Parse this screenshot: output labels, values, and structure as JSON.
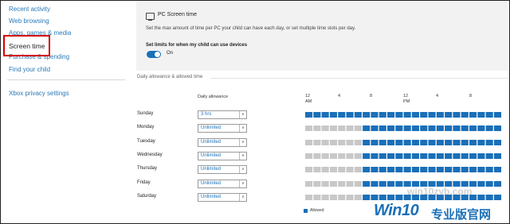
{
  "sidebar": {
    "items": [
      {
        "label": "Recent activity"
      },
      {
        "label": "Web browsing"
      },
      {
        "label": "Apps, games & media"
      },
      {
        "label": "Screen time"
      },
      {
        "label": "Purchase & spending"
      },
      {
        "label": "Find your child"
      },
      {
        "label": "Xbox privacy settings"
      }
    ]
  },
  "pc_screen_time": {
    "title": "PC Screen time",
    "description": "Set the max amount of time per PC your child can have each day, or set multiple time slots per day.",
    "limit_label": "Set limits for when my child can use devices",
    "toggle_state": "On"
  },
  "schedule": {
    "section_label": "Daily allowance & allowed time",
    "allowance_header": "Daily allowance",
    "time_labels": [
      {
        "top": "12",
        "bottom": "AM"
      },
      {
        "top": "4",
        "bottom": ""
      },
      {
        "top": "8",
        "bottom": ""
      },
      {
        "top": "12",
        "bottom": "PM"
      },
      {
        "top": "4",
        "bottom": ""
      },
      {
        "top": "8",
        "bottom": ""
      }
    ],
    "days": [
      {
        "name": "Sunday",
        "allowance": "3 hrs",
        "allowed_from": 0,
        "allowed_to": 24
      },
      {
        "name": "Monday",
        "allowance": "Unlimited",
        "allowed_from": 7,
        "allowed_to": 24
      },
      {
        "name": "Tuesday",
        "allowance": "Unlimited",
        "allowed_from": 7,
        "allowed_to": 24
      },
      {
        "name": "Wednesday",
        "allowance": "Unlimited",
        "allowed_from": 7,
        "allowed_to": 24
      },
      {
        "name": "Thursday",
        "allowance": "Unlimited",
        "allowed_from": 7,
        "allowed_to": 24
      },
      {
        "name": "Friday",
        "allowance": "Unlimited",
        "allowed_from": 7,
        "allowed_to": 24
      },
      {
        "name": "Saturday",
        "allowance": "Unlimited",
        "allowed_from": 7,
        "allowed_to": 24
      }
    ],
    "legend": "Allowed"
  },
  "colors": {
    "allowed": "#1a6fb8",
    "blocked": "#c8c8c8",
    "link": "#2a7ab8",
    "highlight": "#d40000"
  },
  "watermark": {
    "url": "win10zyb.com",
    "logo": "Win10",
    "cn": "专业版官网"
  }
}
